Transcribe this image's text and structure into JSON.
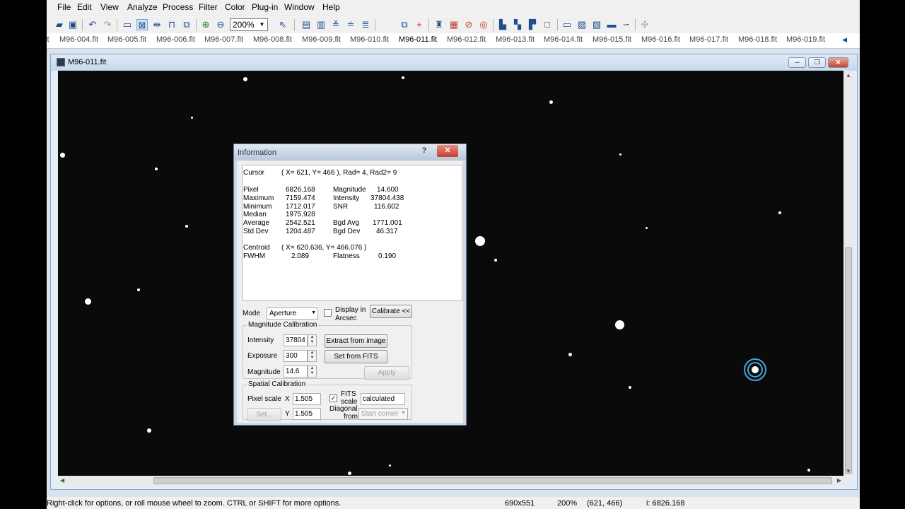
{
  "menu": [
    "File",
    "Edit",
    "View",
    "Analyze",
    "Process",
    "Filter",
    "Color",
    "Plug-in",
    "Window",
    "Help"
  ],
  "toolbar": {
    "zoom_value": "200%"
  },
  "tabs": {
    "partial_left": "it",
    "items": [
      "M96-004.fit",
      "M96-005.fit",
      "M96-006.fit",
      "M96-007.fit",
      "M96-008.fit",
      "M96-009.fit",
      "M96-010.fit",
      "M96-011.fit",
      "M96-012.fit",
      "M96-013.fit",
      "M96-014.fit",
      "M96-015.fit",
      "M96-016.fit",
      "M96-017.fit",
      "M96-018.fit",
      "M96-019.fit"
    ],
    "active_index": 7
  },
  "image_window": {
    "title": "M96-011.fit"
  },
  "info": {
    "title": "Information",
    "help_label": "?",
    "close_label": "✕",
    "cursor_label": "Cursor",
    "cursor_value": "( X= 621, Y= 466 ), Rad= 4, Rad2= 9",
    "pixel_label": "Pixel",
    "pixel": "6826.168",
    "maximum_label": "Maximum",
    "maximum": "7159.474",
    "minimum_label": "Minimum",
    "minimum": "1712.017",
    "median_label": "Median",
    "median": "1975.928",
    "average_label": "Average",
    "average": "2542.521",
    "stddev_label": "Std Dev",
    "stddev": "1204.487",
    "magnitude_label": "Magnitude",
    "magnitude": "14.600",
    "intensity_label": "Intensity",
    "intensity": "37804.438",
    "snr_label": "SNR",
    "snr": "116.602",
    "bgdavg_label": "Bgd Avg",
    "bgdavg": "1771.001",
    "bgddev_label": "Bgd Dev",
    "bgddev": "46.317",
    "centroid_label": "Centroid",
    "centroid": "( X= 620.636, Y= 466.076 )",
    "fwhm_label": "FWHM",
    "fwhm": "2.089",
    "flatness_label": "Flatness",
    "flatness": "0.190",
    "mode_label": "Mode",
    "mode_value": "Aperture",
    "display_arcsec_label_1": "Display in",
    "display_arcsec_label_2": "Arcsec",
    "calibrate_button": "Calibrate <<",
    "mag_cal": {
      "title": "Magnitude Calibration",
      "intensity_label": "Intensity",
      "intensity_value": "37804",
      "exposure_label": "Exposure",
      "exposure_value": "300",
      "magnitude_label": "Magnitude",
      "magnitude_value": "14.6",
      "extract_button": "Extract from image",
      "set_fits_button": "Set from FITS",
      "apply_button": "Apply"
    },
    "spatial_cal": {
      "title": "Spatial Calibration",
      "pixel_scale_label": "Pixel scale",
      "x_label": "X",
      "x_value": "1.505",
      "y_label": "Y",
      "y_value": "1.505",
      "set_button": "Set...",
      "fits_scale_label_1": "FITS",
      "fits_scale_label_2": "scale",
      "fits_checked": true,
      "calculated_value": "calculated",
      "diagonal_label_1": "Diagonal",
      "diagonal_label_2": "from",
      "diagonal_value": "Start corner"
    }
  },
  "status": {
    "hint": "Right-click for options, or roll mouse wheel to zoom. CTRL or SHIFT for more options.",
    "dimensions": "690x551",
    "zoom": "200%",
    "coords": "(621, 466)",
    "value": "i:  6826.168"
  },
  "colors": {
    "title_bar": "#c8d8ec",
    "canvas": "#0a0a0a",
    "close_red": "#c2432f",
    "aperture_ring": "#3fa9d9"
  }
}
